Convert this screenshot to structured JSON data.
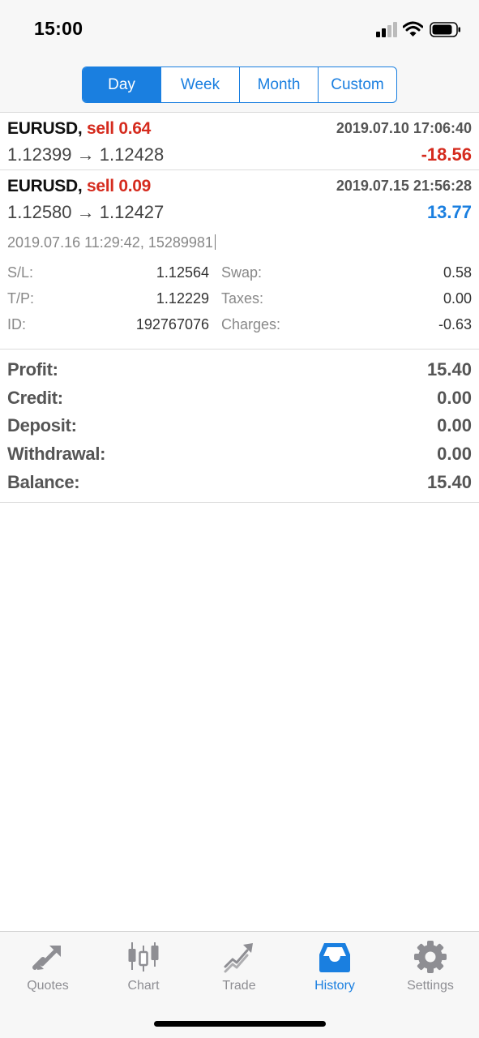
{
  "status": {
    "time": "15:00"
  },
  "segments": [
    {
      "label": "Day",
      "active": true
    },
    {
      "label": "Week",
      "active": false
    },
    {
      "label": "Month",
      "active": false
    },
    {
      "label": "Custom",
      "active": false
    }
  ],
  "deals": [
    {
      "symbol": "EURUSD,",
      "type": "sell 0.64",
      "time": "2019.07.10 17:06:40",
      "prices": "1.12399 → 1.12428",
      "profit": "-18.56"
    },
    {
      "symbol": "EURUSD,",
      "type": "sell 0.09",
      "time": "2019.07.15 21:56:28",
      "prices": "1.12580 → 1.12427",
      "profit": "13.77"
    }
  ],
  "details": {
    "meta": "2019.07.16 11:29:42, 15289981",
    "sl_label": "S/L:",
    "sl_value": "1.12564",
    "tp_label": "T/P:",
    "tp_value": "1.12229",
    "id_label": "ID:",
    "id_value": "192767076",
    "swap_label": "Swap:",
    "swap_value": "0.58",
    "taxes_label": "Taxes:",
    "taxes_value": "0.00",
    "charges_label": "Charges:",
    "charges_value": "-0.63"
  },
  "summary": [
    {
      "label": "Profit:",
      "value": "15.40"
    },
    {
      "label": "Credit:",
      "value": "0.00"
    },
    {
      "label": "Deposit:",
      "value": "0.00"
    },
    {
      "label": "Withdrawal:",
      "value": "0.00"
    },
    {
      "label": "Balance:",
      "value": "15.40"
    }
  ],
  "tabbar": [
    {
      "label": "Quotes",
      "icon": "quotes-icon"
    },
    {
      "label": "Chart",
      "icon": "chart-icon"
    },
    {
      "label": "Trade",
      "icon": "trade-icon"
    },
    {
      "label": "History",
      "icon": "history-icon",
      "active": true
    },
    {
      "label": "Settings",
      "icon": "settings-icon"
    }
  ],
  "colors": {
    "accent": "#1a7fe0",
    "negative": "#d52b1e",
    "inactive_tab": "#8e8e93"
  }
}
